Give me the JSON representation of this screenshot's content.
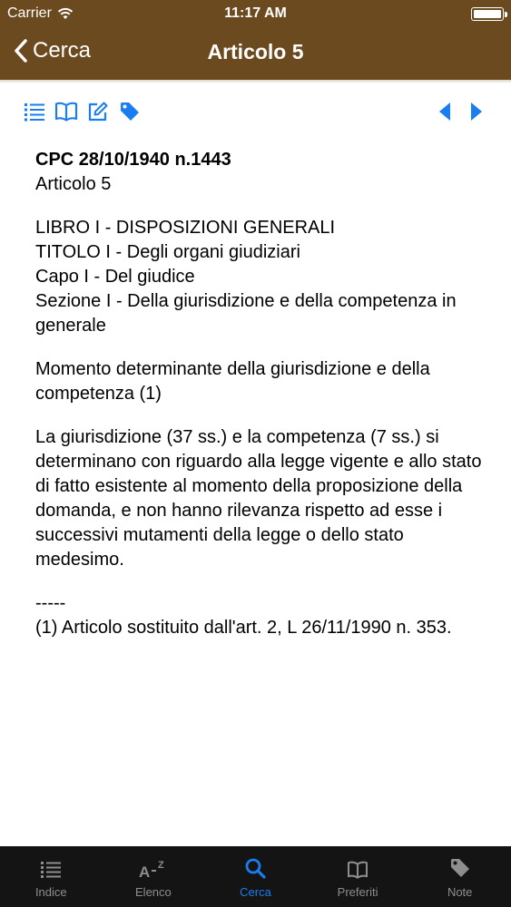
{
  "status_bar": {
    "carrier": "Carrier",
    "time": "11:17 AM"
  },
  "nav_bar": {
    "back_label": "Cerca",
    "title": "Articolo 5",
    "background_color": "#6b4a1f"
  },
  "toolbar": {
    "icons": [
      "list-icon",
      "book-icon",
      "edit-icon",
      "tag-icon",
      "previous-arrow-icon",
      "next-arrow-icon"
    ],
    "accent_color": "#1a7ef0"
  },
  "article": {
    "code_reference": "CPC 28/10/1940 n.1443",
    "article_label": "Articolo 5",
    "hierarchy": {
      "libro": "LIBRO I - DISPOSIZIONI GENERALI",
      "titolo": "TITOLO I - Degli organi giudiziari",
      "capo": "Capo I - Del giudice",
      "sezione": "Sezione I - Della giurisdizione e della competenza in generale"
    },
    "heading": "Momento determinante della giurisdizione e della competenza (1)",
    "body": "La giurisdizione (37 ss.) e la competenza (7 ss.) si determinano con riguardo alla legge vigente e allo stato di fatto esistente al momento della proposizione della domanda, e non hanno rilevanza rispetto ad esse i successivi mutamenti della legge o dello stato medesimo.",
    "separator": "-----",
    "footnote": "(1) Articolo sostituito dall'art. 2, L 26/11/1990 n. 353."
  },
  "tab_bar": {
    "active_tab": "Cerca",
    "active_color": "#1a7ef0",
    "tabs": [
      {
        "label": "Indice",
        "icon": "list-icon"
      },
      {
        "label": "Elenco",
        "icon": "az-sort-icon"
      },
      {
        "label": "Cerca",
        "icon": "search-icon"
      },
      {
        "label": "Preferiti",
        "icon": "book-icon"
      },
      {
        "label": "Note",
        "icon": "tag-icon"
      }
    ]
  }
}
